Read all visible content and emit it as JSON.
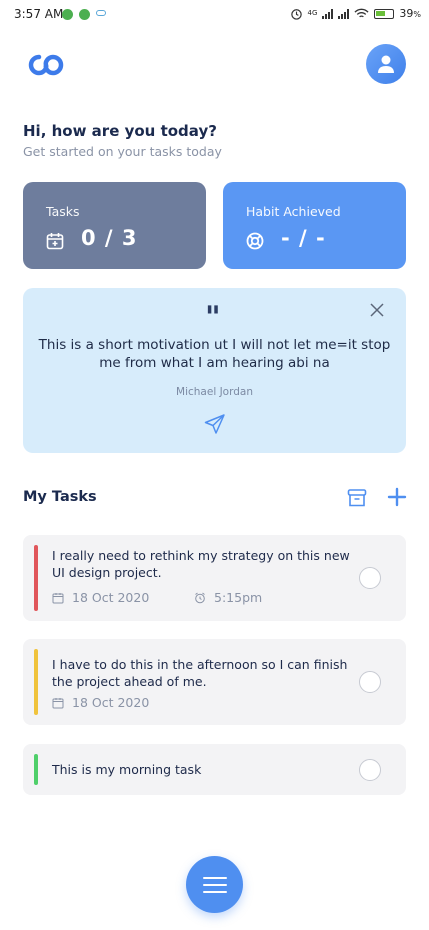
{
  "status": {
    "time": "3:57 AM",
    "network_badge": "4G",
    "battery": "39",
    "battery_unit": "%"
  },
  "greeting": {
    "title": "Hi, how are you today?",
    "subtitle": "Get started on your tasks today"
  },
  "cards": {
    "tasks": {
      "label": "Tasks",
      "value": "0 / 3",
      "icon": "calendar-plus-icon"
    },
    "habit": {
      "label": "Habit Achieved",
      "value": "- / -",
      "icon": "lifebuoy-icon"
    }
  },
  "quote": {
    "mark": "\"",
    "text": "This is a short motivation ut I will not let me=it stop me from what I am hearing abi na",
    "author": "Michael Jordan"
  },
  "my_tasks": {
    "title": "My Tasks",
    "items": [
      {
        "title": "I really need to rethink my strategy on this new UI design project.",
        "date": "18 Oct 2020",
        "time": "5:15pm",
        "color": "#e0565b"
      },
      {
        "title": "I have to do this in the afternoon so I can finish the project ahead of me.",
        "date": "18 Oct 2020",
        "color": "#f0c33c"
      },
      {
        "title": "This is my morning task",
        "color": "#4fcf6a"
      }
    ]
  },
  "colors": {
    "accent": "#4f8ff0",
    "tasks_card": "#6e7d9d",
    "habit_card": "#5a97f3",
    "quote_bg": "#d7ecfb"
  }
}
